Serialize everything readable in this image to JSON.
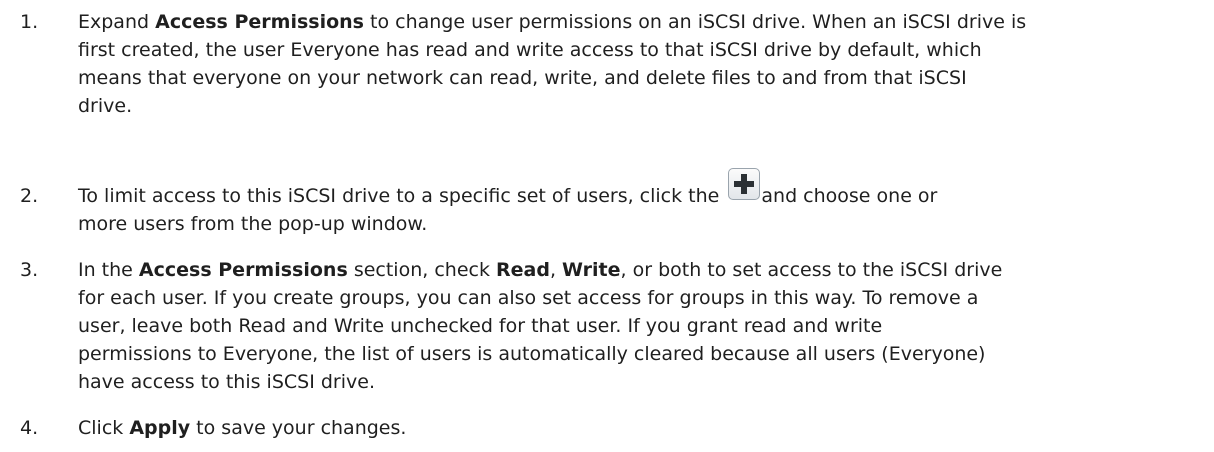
{
  "steps": [
    {
      "number": "1.",
      "lines": [
        {
          "t1": "Expand ",
          "b1": "Access Permissions",
          "t2": " to change user permissions on an iSCSI drive. When an iSCSI drive is"
        },
        {
          "t1": "first created, the user Everyone has read and write access to that iSCSI drive by default, which"
        },
        {
          "t1": "means that everyone on your network can read, write, and delete files to and from that iSCSI"
        },
        {
          "t1": "drive."
        }
      ]
    },
    {
      "number": "2.",
      "lines": [
        {
          "t1": "To limit access to this iSCSI drive to a specific set of users, click the ",
          "icon": "plus-icon",
          "t2": "and choose one or"
        },
        {
          "t1": "more users from the pop-up window."
        }
      ]
    },
    {
      "number": "3.",
      "lines": [
        {
          "t1": "In the ",
          "b1": "Access Permissions",
          "t2": " section, check ",
          "b2": "Read",
          "t3": ", ",
          "b3": "Write",
          "t4": ", or both to set access to the iSCSI drive"
        },
        {
          "t1": "for each user. If you create groups, you can also set access for groups in this way. To remove a"
        },
        {
          "t1": "user, leave both Read and Write unchecked for that user. If you grant read and write"
        },
        {
          "t1": "permissions to Everyone, the list of users is automatically cleared because all users (Everyone)"
        },
        {
          "t1": "have access to this iSCSI drive."
        }
      ]
    },
    {
      "number": "4.",
      "lines": [
        {
          "t1": "Click ",
          "b1": "Apply",
          "t2": " to save your changes."
        }
      ]
    }
  ]
}
